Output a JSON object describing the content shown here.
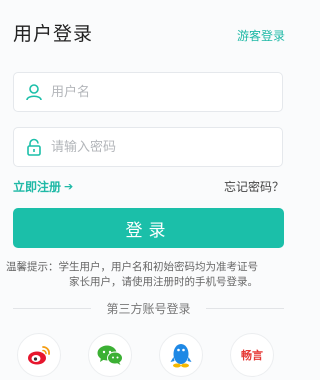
{
  "header": {
    "title": "用户登录",
    "guest_login": "游客登录"
  },
  "form": {
    "username_placeholder": "用户名",
    "password_placeholder": "请输入密码",
    "register_label": "立即注册",
    "forgot_label": "忘记密码？",
    "login_label": "登录"
  },
  "tip": {
    "line1": "温馨提示：学生用户，用户名和初始密码均为准考证号",
    "line2": "家长用户，请使用注册时的手机号登录。"
  },
  "third_party": {
    "title": "第三方账号登录",
    "providers": [
      "weibo",
      "wechat",
      "qq",
      "yixin"
    ],
    "yixin_text": "畅言"
  },
  "colors": {
    "accent": "#1bbfa9",
    "weibo": "#e6162d",
    "wechat": "#3cb034",
    "qq": "#1e88e5"
  }
}
